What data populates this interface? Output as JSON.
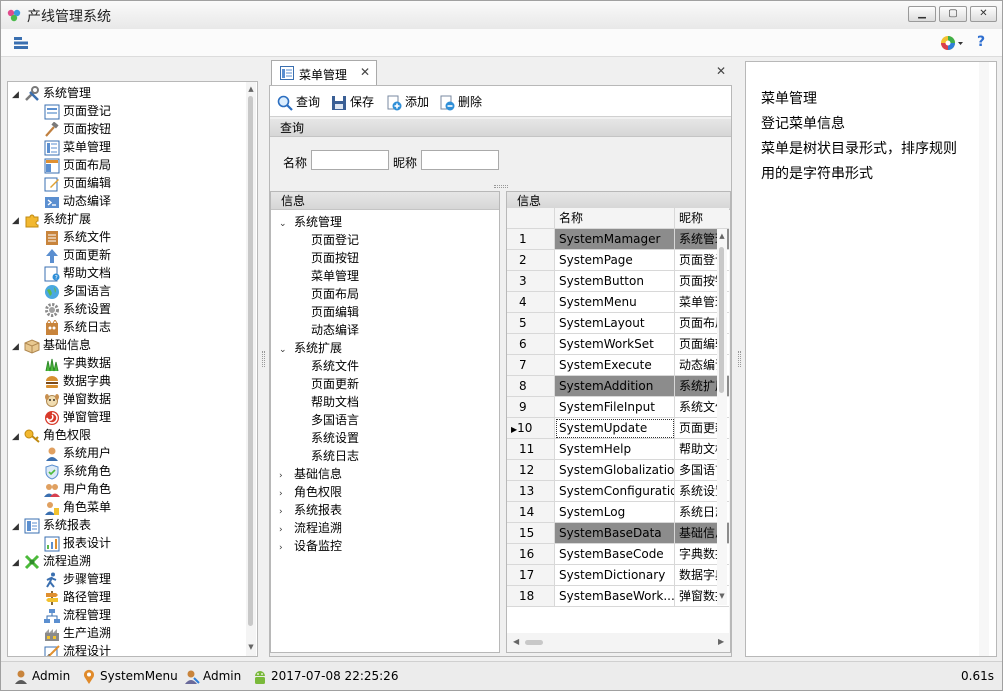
{
  "window": {
    "title": "产线管理系统"
  },
  "left_tree": [
    {
      "label": "系统管理",
      "level": 0,
      "expanded": true,
      "icon": "tools-icon"
    },
    {
      "label": "页面登记",
      "level": 1,
      "icon": "page-register-icon"
    },
    {
      "label": "页面按钮",
      "level": 1,
      "icon": "hammer-icon"
    },
    {
      "label": "菜单管理",
      "level": 1,
      "icon": "menu-icon"
    },
    {
      "label": "页面布局",
      "level": 1,
      "icon": "layout-icon"
    },
    {
      "label": "页面编辑",
      "level": 1,
      "icon": "edit-icon"
    },
    {
      "label": "动态编译",
      "level": 1,
      "icon": "compile-icon"
    },
    {
      "label": "系统扩展",
      "level": 0,
      "expanded": true,
      "icon": "puzzle-icon"
    },
    {
      "label": "系统文件",
      "level": 1,
      "icon": "file-icon"
    },
    {
      "label": "页面更新",
      "level": 1,
      "icon": "up-arrow-icon"
    },
    {
      "label": "帮助文档",
      "level": 1,
      "icon": "help-doc-icon"
    },
    {
      "label": "多国语言",
      "level": 1,
      "icon": "globe-icon"
    },
    {
      "label": "系统设置",
      "level": 1,
      "icon": "gear-icon"
    },
    {
      "label": "系统日志",
      "level": 1,
      "icon": "log-icon"
    },
    {
      "label": "基础信息",
      "level": 0,
      "expanded": true,
      "icon": "box-icon"
    },
    {
      "label": "字典数据",
      "level": 1,
      "icon": "grass-icon"
    },
    {
      "label": "数据字典",
      "level": 1,
      "icon": "burger-icon"
    },
    {
      "label": "弹窗数据",
      "level": 1,
      "icon": "dog-icon"
    },
    {
      "label": "弹窗管理",
      "level": 1,
      "icon": "swirl-icon"
    },
    {
      "label": "角色权限",
      "level": 0,
      "expanded": true,
      "icon": "key-icon"
    },
    {
      "label": "系统用户",
      "level": 1,
      "icon": "user-icon"
    },
    {
      "label": "系统角色",
      "level": 1,
      "icon": "shield-icon"
    },
    {
      "label": "用户角色",
      "level": 1,
      "icon": "users-icon"
    },
    {
      "label": "角色菜单",
      "level": 1,
      "icon": "user-menu-icon"
    },
    {
      "label": "系统报表",
      "level": 0,
      "expanded": true,
      "icon": "report-icon"
    },
    {
      "label": "报表设计",
      "level": 1,
      "icon": "report-design-icon"
    },
    {
      "label": "流程追溯",
      "level": 0,
      "expanded": true,
      "icon": "flow-icon"
    },
    {
      "label": "步骤管理",
      "level": 1,
      "icon": "walker-icon"
    },
    {
      "label": "路径管理",
      "level": 1,
      "icon": "signpost-icon"
    },
    {
      "label": "流程管理",
      "level": 1,
      "icon": "org-chart-icon"
    },
    {
      "label": "生产追溯",
      "level": 1,
      "icon": "production-icon"
    },
    {
      "label": "流程设计",
      "level": 1,
      "icon": "design-icon"
    }
  ],
  "tab": {
    "label": "菜单管理"
  },
  "toolbar": {
    "query": "查询",
    "save": "保存",
    "add": "添加",
    "delete": "删除"
  },
  "query_panel": {
    "header": "查询",
    "name_label": "名称",
    "nick_label": "昵称",
    "name_value": "",
    "nick_value": ""
  },
  "info_tree": {
    "header": "信息",
    "items": [
      {
        "label": "系统管理",
        "level": 0,
        "arrow": "down"
      },
      {
        "label": "页面登记",
        "level": 1
      },
      {
        "label": "页面按钮",
        "level": 1
      },
      {
        "label": "菜单管理",
        "level": 1
      },
      {
        "label": "页面布局",
        "level": 1
      },
      {
        "label": "页面编辑",
        "level": 1
      },
      {
        "label": "动态编译",
        "level": 1
      },
      {
        "label": "系统扩展",
        "level": 0,
        "arrow": "down"
      },
      {
        "label": "系统文件",
        "level": 1
      },
      {
        "label": "页面更新",
        "level": 1
      },
      {
        "label": "帮助文档",
        "level": 1
      },
      {
        "label": "多国语言",
        "level": 1
      },
      {
        "label": "系统设置",
        "level": 1
      },
      {
        "label": "系统日志",
        "level": 1
      },
      {
        "label": "基础信息",
        "level": 0,
        "arrow": "right"
      },
      {
        "label": "角色权限",
        "level": 0,
        "arrow": "right"
      },
      {
        "label": "系统报表",
        "level": 0,
        "arrow": "right"
      },
      {
        "label": "流程追溯",
        "level": 0,
        "arrow": "right"
      },
      {
        "label": "设备监控",
        "level": 0,
        "arrow": "right"
      }
    ]
  },
  "info_grid": {
    "header": "信息",
    "columns": [
      "名称",
      "昵称"
    ],
    "current_row": "10",
    "rows": [
      {
        "num": "1",
        "name": "SystemMamager",
        "nick": "系统管理",
        "highlight": true
      },
      {
        "num": "2",
        "name": "SystemPage",
        "nick": "页面登记"
      },
      {
        "num": "3",
        "name": "SystemButton",
        "nick": "页面按钮"
      },
      {
        "num": "4",
        "name": "SystemMenu",
        "nick": "菜单管理"
      },
      {
        "num": "5",
        "name": "SystemLayout",
        "nick": "页面布局"
      },
      {
        "num": "6",
        "name": "SystemWorkSet",
        "nick": "页面编辑"
      },
      {
        "num": "7",
        "name": "SystemExecute",
        "nick": "动态编译"
      },
      {
        "num": "8",
        "name": "SystemAddition",
        "nick": "系统扩展",
        "highlight": true
      },
      {
        "num": "9",
        "name": "SystemFileInput",
        "nick": "系统文件"
      },
      {
        "num": "10",
        "name": "SystemUpdate",
        "nick": "页面更新",
        "current": true
      },
      {
        "num": "11",
        "name": "SystemHelp",
        "nick": "帮助文档"
      },
      {
        "num": "12",
        "name": "SystemGlobalization",
        "nick": "多国语言"
      },
      {
        "num": "13",
        "name": "SystemConfiguration",
        "nick": "系统设置"
      },
      {
        "num": "14",
        "name": "SystemLog",
        "nick": "系统日志"
      },
      {
        "num": "15",
        "name": "SystemBaseData",
        "nick": "基础信息",
        "highlight": true
      },
      {
        "num": "16",
        "name": "SystemBaseCode",
        "nick": "字典数据"
      },
      {
        "num": "17",
        "name": "SystemDictionary",
        "nick": "数据字典"
      },
      {
        "num": "18",
        "name": "SystemBaseWork...",
        "nick": "弹窗数据"
      }
    ]
  },
  "description": [
    "菜单管理",
    "登记菜单信息",
    "菜单是树状目录形式，排序规则",
    "用的是字符串形式"
  ],
  "statusbar": {
    "user1": "Admin",
    "page": "SystemMenu",
    "user2": "Admin",
    "datetime": "2017-07-08 22:25:26",
    "timing": "0.61s"
  },
  "colors": {
    "highlight_row": "#8c8c8c",
    "panel_header": "#dcdcdc"
  }
}
